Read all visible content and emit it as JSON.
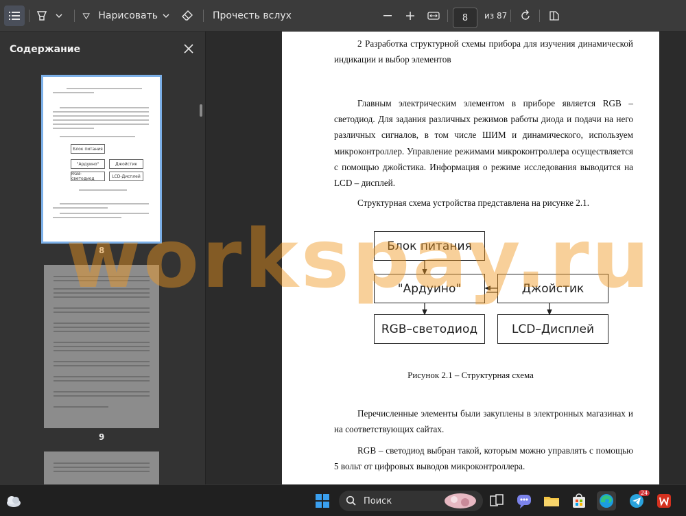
{
  "toolbar": {
    "draw_label": "Нарисовать",
    "read_aloud_label": "Прочесть вслух",
    "page_current": "8",
    "page_total": "из 87"
  },
  "sidebar": {
    "title": "Содержание",
    "thumbnails": [
      {
        "page": "8",
        "selected": true
      },
      {
        "page": "9",
        "selected": false
      }
    ],
    "thumb8_diagram": {
      "power": "Блок питания",
      "arduino": "\"Ардуино\"",
      "joystick": "Джойстик",
      "rgb": "RGB-светодиод",
      "lcd": "LCD-Дисплей"
    }
  },
  "document": {
    "heading": "2 Разработка структурной схемы прибора для изучения динамической индикации и выбор элементов",
    "para1": "Главным электрическим элементом в приборе является RGB – светодиод. Для задания различных режимов работы диода и подачи на него различных сигналов, в том числе ШИМ и динамического, используем микроконтроллер. Управление режимами микроконтроллера осуществляется с помощью джойстика. Информация о режиме исследования выводится на LCD – дисплей.",
    "para2": "Структурная схема устройства представлена на рисунке 2.1.",
    "diagram": {
      "power": "Блок питания",
      "arduino": "\"Ардуино\"",
      "joystick": "Джойстик",
      "rgb": "RGB–светодиод",
      "lcd": "LCD–Дисплей"
    },
    "caption": "Рисунок 2.1 – Структурная схема",
    "para3": "Перечисленные элементы были закуплены в электронных магазинах и на соответствующих сайтах.",
    "para4": "RGB – светодиод выбран такой, которым можно управлять с помощью 5 вольт от цифровых выводов микроконтроллера."
  },
  "watermark": "workspay.ru",
  "taskbar": {
    "search_label": "Поиск",
    "telegram_badge": "24"
  },
  "colors": {
    "accent": "#7cb0e8",
    "watermark": "#f0961e"
  }
}
